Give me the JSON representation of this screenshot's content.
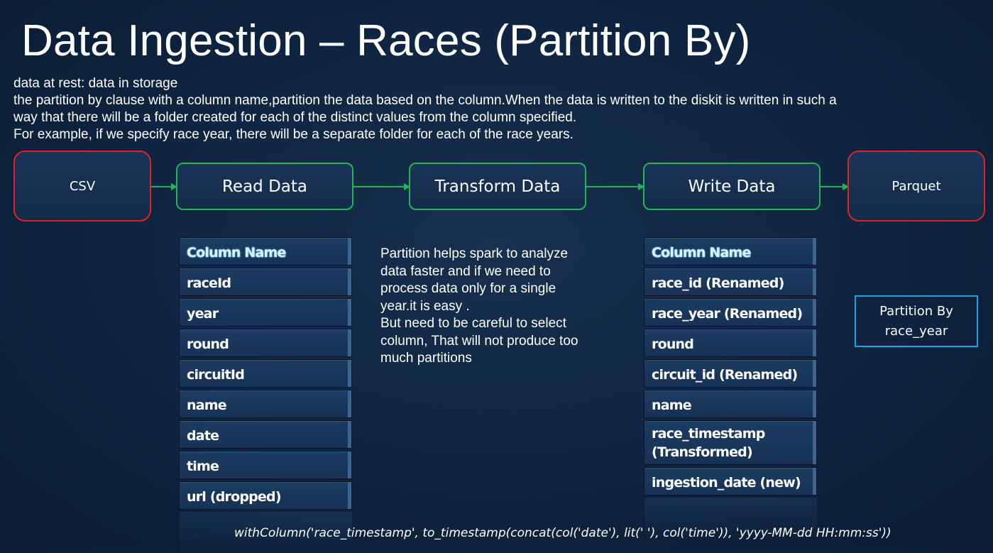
{
  "slide": {
    "title": "Data Ingestion – Races (Partition By)",
    "intro": [
      "data at rest: data in storage",
      "the partition by clause with a column name,partition the data based on the column.When the data is written to the diskit is written in such a",
      "way that there will be a folder created for each of the distinct values from the column specified.",
      "For example, if we specify race year, there will be a separate folder for each of the race years."
    ]
  },
  "pipeline": {
    "source": "CSV",
    "read": "Read Data",
    "transform": "Transform Data",
    "write": "Write Data",
    "target": "Parquet"
  },
  "source_columns": {
    "header": "Column Name",
    "rows": [
      "raceId",
      "year",
      "round",
      "circuitId",
      "name",
      "date",
      "time",
      "url (dropped)"
    ]
  },
  "target_columns": {
    "header": "Column Name",
    "rows": [
      "race_id (Renamed)",
      "race_year (Renamed)",
      "round",
      "circuit_id (Renamed)",
      "name",
      "race_timestamp (Transformed)",
      "ingestion_date (new)"
    ]
  },
  "note": {
    "lines": [
      "Partition helps spark to analyze",
      "data faster and if we need to",
      "process data only for a single",
      "year.it is easy .",
      "But need to be careful to select",
      "column, That will not produce too",
      "much partitions"
    ]
  },
  "partition_box": {
    "line1": "Partition By",
    "line2": "race_year"
  },
  "code_line": "withColumn('race_timestamp', to_timestamp(concat(col('date'), lit(' '), col('time')), 'yyyy-MM-dd HH:mm:ss'))",
  "colors": {
    "background": "#0f2440",
    "box_fill": "#173256",
    "red_border": "#e0202b",
    "green_border": "#23b55a",
    "partition_border": "#1aa4e6",
    "header_glow": "#6fd3ff"
  }
}
